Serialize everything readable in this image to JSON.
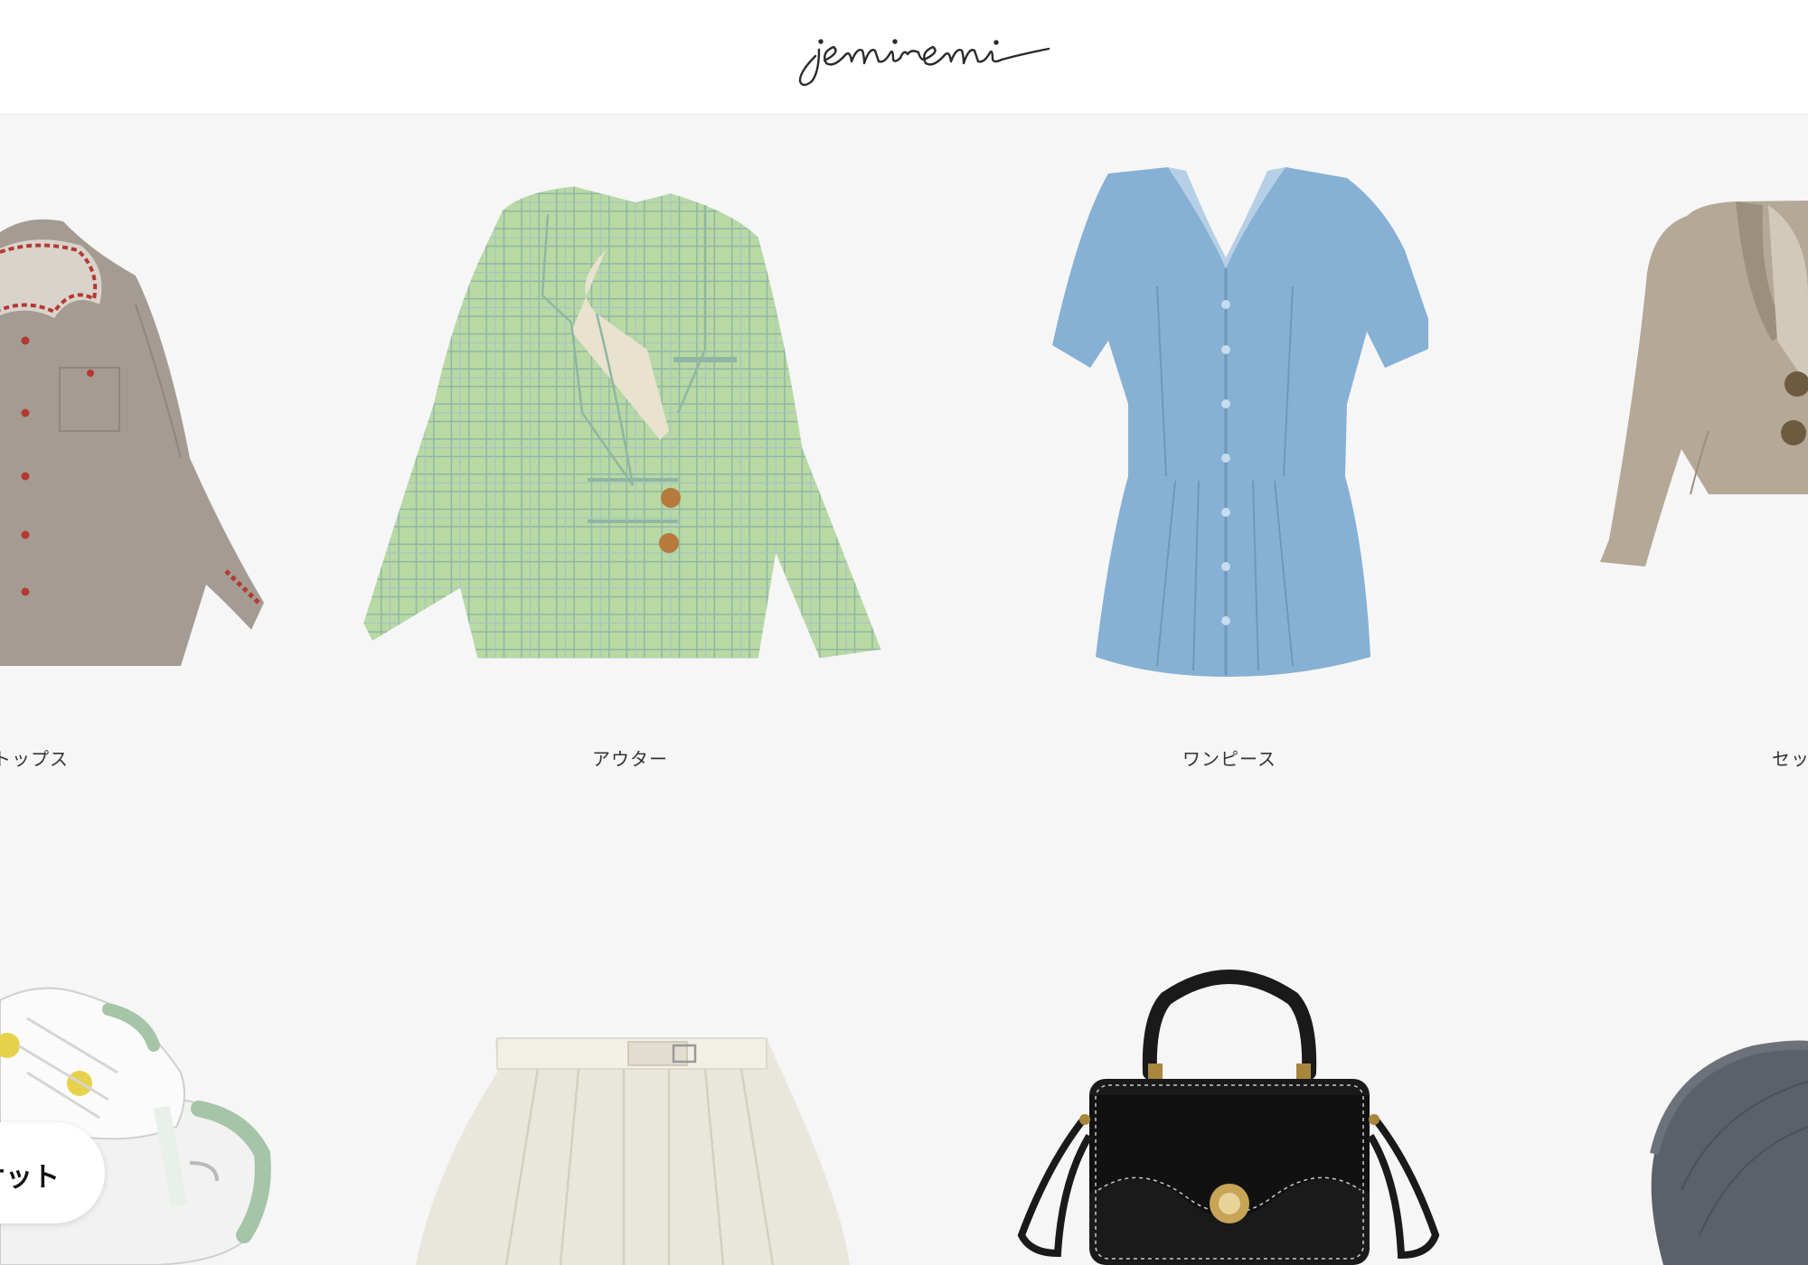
{
  "header": {
    "logo_text": "jemiremi"
  },
  "categories": [
    {
      "label": "トップス",
      "icon": "blouse"
    },
    {
      "label": "アウター",
      "icon": "plaid-blazer"
    },
    {
      "label": "ワンピース",
      "icon": "denim-dress"
    },
    {
      "label": "セッ",
      "icon": "beige-jacket"
    },
    {
      "label": "",
      "icon": "sneakers"
    },
    {
      "label": "",
      "icon": "pleated-skirt"
    },
    {
      "label": "",
      "icon": "handbag"
    },
    {
      "label": "",
      "icon": "newsboy-cap"
    }
  ],
  "floating": {
    "label": "ケット"
  },
  "colors": {
    "background": "#f6f6f6",
    "header_bg": "#ffffff",
    "text": "#333333",
    "denim": "#86b0d4",
    "plaid_green": "#b9d9a4",
    "blouse_gray": "#a49c92",
    "beige": "#b4a896",
    "black_bag": "#1a1a1a",
    "cap_gray": "#5c6068"
  }
}
